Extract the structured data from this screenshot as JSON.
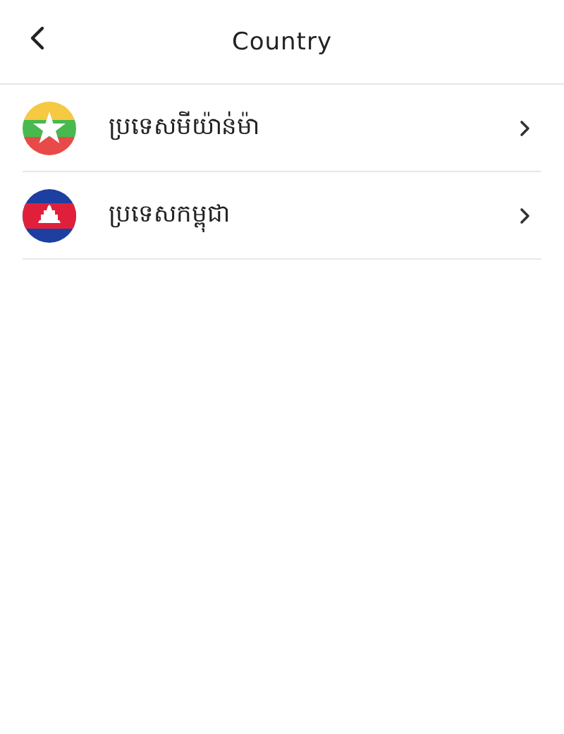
{
  "header": {
    "title": "Country"
  },
  "countries": [
    {
      "name": "ប្រទេសមីយ៉ាន់ម៉ា",
      "kind": "myanmar"
    },
    {
      "name": "ប្រទេសកម្ពុជា",
      "kind": "cambodia"
    }
  ]
}
